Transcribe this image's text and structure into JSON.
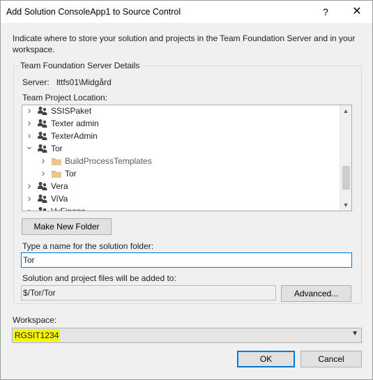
{
  "dialog": {
    "title": "Add Solution ConsoleApp1 to Source Control",
    "help_glyph": "?",
    "close_glyph": "✕",
    "instructions": "Indicate where to store your solution and projects in the Team Foundation Server and in your workspace."
  },
  "server_details": {
    "group_title": "Team Foundation Server Details",
    "server_label": "Server:",
    "server_value": "lttfs01\\Midgård",
    "location_label": "Team Project Location:"
  },
  "tree": {
    "items": [
      {
        "label": "SSISPaket",
        "icon": "team-project-icon",
        "expanded": false,
        "selected": false
      },
      {
        "label": "Texter admin",
        "icon": "team-project-icon",
        "expanded": false,
        "selected": false
      },
      {
        "label": "TexterAdmin",
        "icon": "team-project-icon",
        "expanded": false,
        "selected": false
      },
      {
        "label": "Tor",
        "icon": "team-project-icon",
        "expanded": true,
        "selected": false
      },
      {
        "label": "BuildProcessTemplates",
        "icon": "folder-icon",
        "expanded": false,
        "selected": false,
        "dim": true
      },
      {
        "label": "Tor",
        "icon": "folder-icon",
        "expanded": false,
        "selected": false
      },
      {
        "label": "Vera",
        "icon": "team-project-icon",
        "expanded": false,
        "selected": false
      },
      {
        "label": "ViVa",
        "icon": "team-project-icon",
        "expanded": false,
        "selected": false
      },
      {
        "label": "VyFinans",
        "icon": "team-project-icon",
        "expanded": false,
        "selected": false
      }
    ],
    "scroll_up_glyph": "▲",
    "scroll_down_glyph": "▼"
  },
  "buttons": {
    "make_new_folder": "Make New Folder",
    "advanced": "Advanced...",
    "ok": "OK",
    "cancel": "Cancel"
  },
  "solution_folder": {
    "label": "Type a name for the solution folder:",
    "value": "Tor"
  },
  "target_path": {
    "label": "Solution and project files will be added to:",
    "value": "$/Tor/Tor"
  },
  "workspace": {
    "label": "Workspace:",
    "value": "RGSIT1234",
    "highlight_color": "#f5f500"
  }
}
